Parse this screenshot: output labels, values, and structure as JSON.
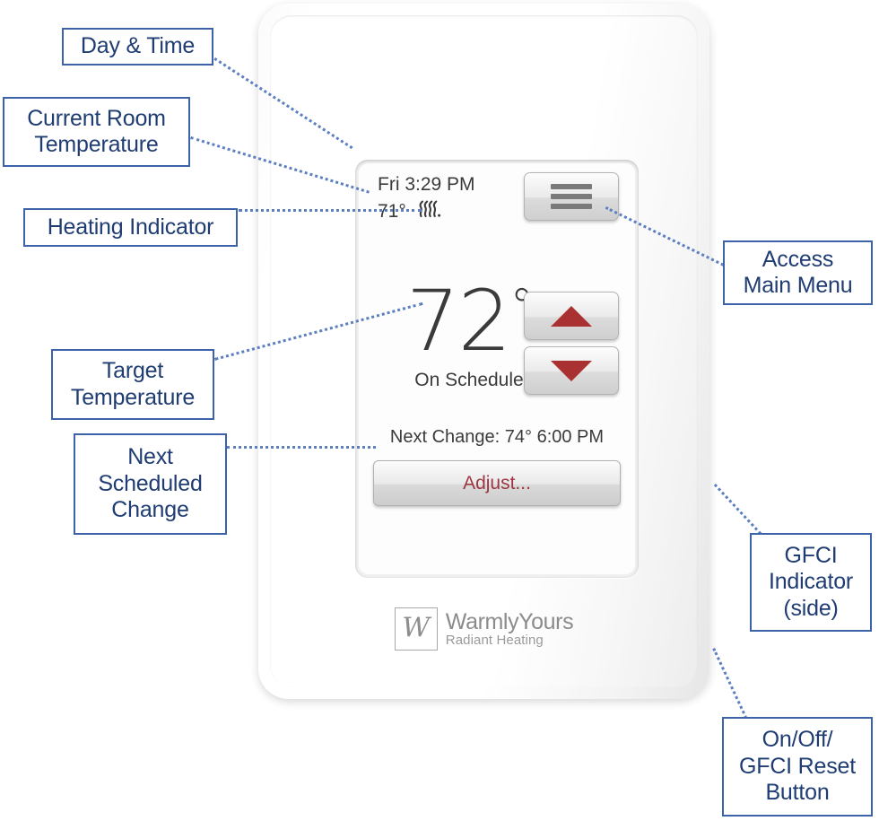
{
  "device": {
    "brand_name": "WarmlyYours",
    "brand_tagline": "Radiant Heating",
    "brand_monogram": "W"
  },
  "screen": {
    "day_time": "Fri 3:29 PM",
    "room_temperature": "71°",
    "heating_indicator_icon": "heat-waves-icon",
    "menu_icon": "hamburger-menu-icon",
    "target_temperature": "72",
    "degree_symbol": "°",
    "schedule_status": "On Schedule",
    "up_icon": "triangle-up-icon",
    "down_icon": "triangle-down-icon",
    "next_change": "Next Change: 74°  6:00 PM",
    "adjust_label": "Adjust...",
    "adjust_color": "#9d3640",
    "arrow_color": "#a93131"
  },
  "callouts": [
    {
      "id": "day-time",
      "text": "Day & Time"
    },
    {
      "id": "current-room",
      "text": "Current Room\nTemperature"
    },
    {
      "id": "heating",
      "text": "Heating Indicator"
    },
    {
      "id": "target-temp",
      "text": "Target\nTemperature"
    },
    {
      "id": "next-change",
      "text": "Next\nScheduled\nChange"
    },
    {
      "id": "access-menu",
      "text": "Access\nMain Menu"
    },
    {
      "id": "gfci-indicator",
      "text": "GFCI\nIndicator\n(side)"
    },
    {
      "id": "onoff-reset",
      "text": "On/Off/\nGFCI Reset\nButton"
    }
  ],
  "style": {
    "callout_border_color": "#3c62aa",
    "callout_text_color": "#1f3c73",
    "leader_color": "#5b7fc0"
  }
}
